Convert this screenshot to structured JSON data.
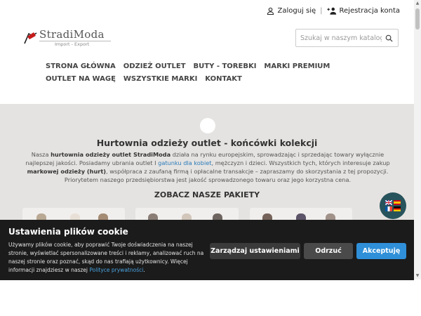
{
  "topbar": {
    "login": "Zaloguj się",
    "separator": "|",
    "register": "Rejestracja konta"
  },
  "logo": {
    "brand": "StradiModa",
    "tagline": "Import - Export"
  },
  "search": {
    "placeholder": "Szukaj w naszym katalogu"
  },
  "nav": {
    "items": [
      "STRONA GŁÓWNA",
      "ODZIEŻ OUTLET",
      "BUTY - TOREBKI",
      "MARKI PREMIUM",
      "OUTLET NA WAGĘ",
      "WSZYSTKIE MARKI",
      "KONTAKT"
    ]
  },
  "hero": {
    "title": "Hurtownia odzieży outlet - końcówki kolekcji",
    "desc": {
      "p1": "Nasza ",
      "b1": "hurtownia odzieży outlet StradiModa",
      "p2": " działa na rynku europejskim, sprowadzając i sprzedając towary wyłącznie najlepszej jakości. Posiadamy ubrania outlet I ",
      "link": "gatunku dla kobiet",
      "p3": ", mężczyzn i dzieci. Wszystkich tych, których interesuje zakup ",
      "b2": "markowej odzieży (hurt)",
      "p4": ", współpraca z zaufaną firmą i opłacalne transakcje – zapraszamy do skorzystania z tej propozycji. Priorytetem naszego przedsiębiorstwa jest jakość sprowadzonego towaru oraz jego korzystna cena."
    },
    "packages_heading": "ZOBACZ NASZE PAKIETY"
  },
  "cookie": {
    "title": "Ustawienia plików cookie",
    "text": "Używamy plików cookie, aby poprawić Twoje doświadczenia na naszej stronie, wyświetlać spersonalizowane treści i reklamy, analizować ruch na naszej stronie oraz poznać, skąd do nas trafiają użytkownicy. Więcej informacji znajdziesz w naszej ",
    "link": "Polityce prywatności",
    "text_end": ".",
    "manage": "Zarządzaj ustawieniami",
    "refuse": "Odrzuć",
    "accept": "Akceptuję"
  },
  "language_switcher": {
    "flags": [
      "uk",
      "spain",
      "france",
      "germany"
    ]
  },
  "colors": {
    "accent": "#2f8fd8",
    "hero_bg": "#e5e3e1",
    "cookie_bg": "#1b1b1b",
    "lang_bg": "#27535c"
  }
}
